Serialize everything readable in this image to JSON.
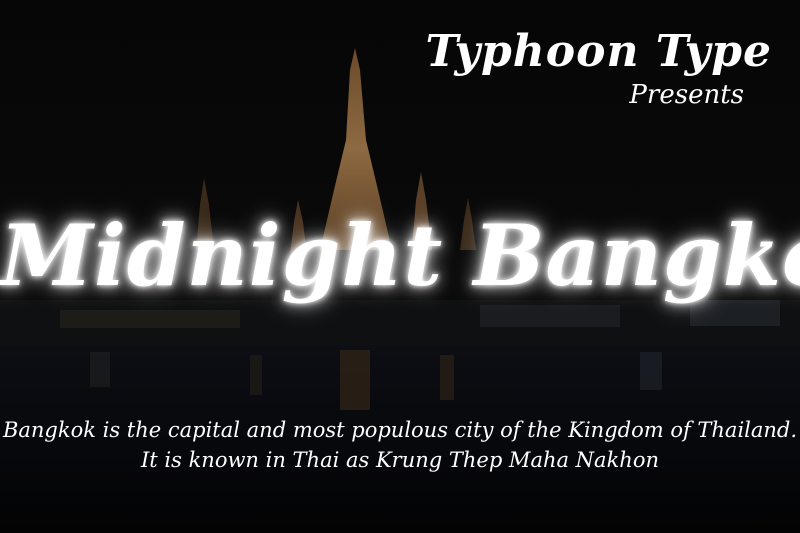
{
  "brand": {
    "name": "Typhoon Type",
    "tagline": "Presents"
  },
  "title": "Midnight Bangkok",
  "description": [
    "Bangkok is the capital and most populous city of the Kingdom of Thailand.",
    "It is known in Thai as Krung Thep Maha Nakhon"
  ]
}
